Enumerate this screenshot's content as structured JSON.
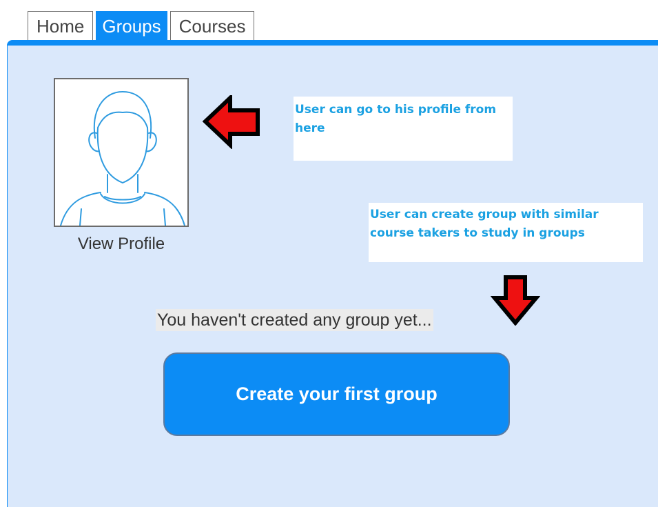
{
  "tabs": [
    {
      "label": "Home",
      "active": false
    },
    {
      "label": "Groups",
      "active": true
    },
    {
      "label": "Courses",
      "active": false
    }
  ],
  "profile": {
    "view_label": "View Profile",
    "icon": "user-avatar-icon"
  },
  "annotations": {
    "profile_note": "User can go to his profile from here",
    "group_note": "User can create group with similar course takers to study in groups"
  },
  "groups": {
    "empty_message": "You haven't created any group yet...",
    "create_button_label": "Create your first group"
  },
  "colors": {
    "accent": "#0c8cf5",
    "panel_bg": "#dae8fb",
    "annotation_text": "#1ba1e2",
    "arrow_fill": "#ee1111"
  }
}
